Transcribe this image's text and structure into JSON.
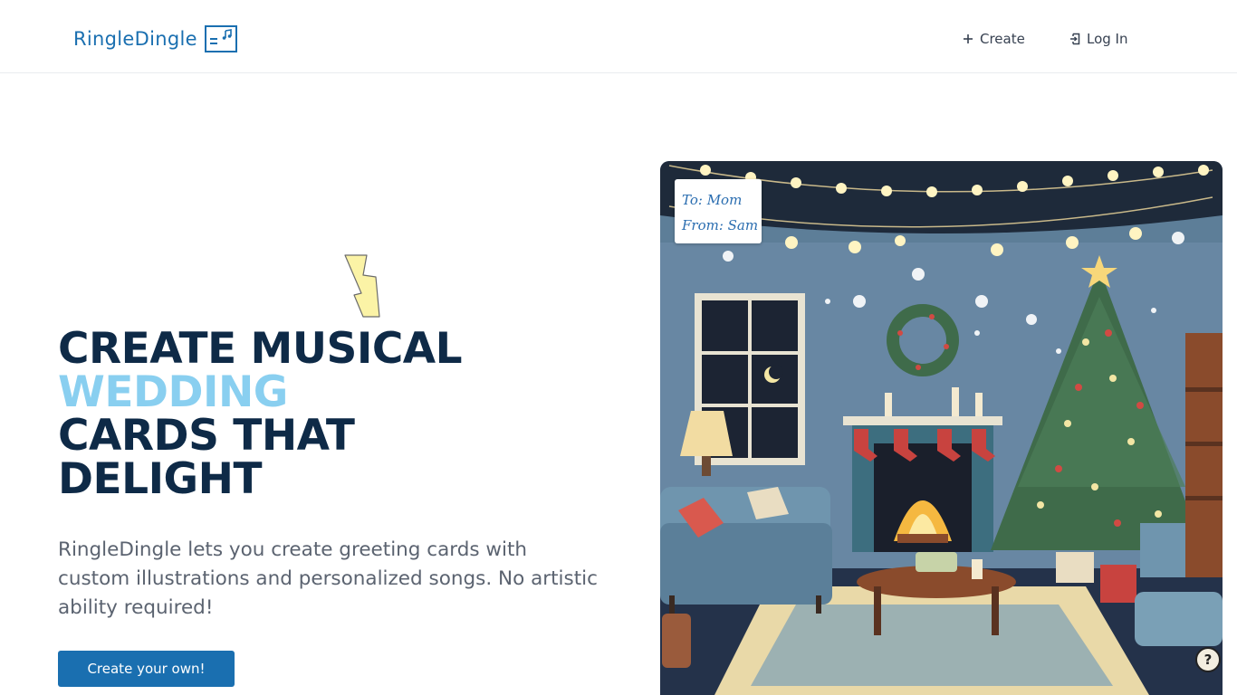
{
  "header": {
    "logo_text": "RingleDingle",
    "nav": {
      "create_label": "Create",
      "login_label": "Log In"
    }
  },
  "hero": {
    "headline": {
      "line1": "CREATE MUSICAL",
      "line2": "WEDDING",
      "line3": "CARDS THAT",
      "line4": "DELIGHT"
    },
    "description": "RingleDingle lets you create greeting cards with custom illustrations and personalized songs. No artistic ability required!",
    "cta_label": "Create your own!"
  },
  "card": {
    "tag_to": "To: Mom",
    "tag_from": "From: Sam"
  },
  "help": {
    "symbol": "?"
  },
  "colors": {
    "brand": "#1a6fb0",
    "headline": "#0e2a47",
    "accent": "#89cff0",
    "body_text": "#5b6370"
  },
  "icons": {
    "logo": "music-card-icon",
    "create": "plus-icon",
    "login": "login-door-icon",
    "decor": "lightning-bolt-icon",
    "help": "help-icon"
  }
}
